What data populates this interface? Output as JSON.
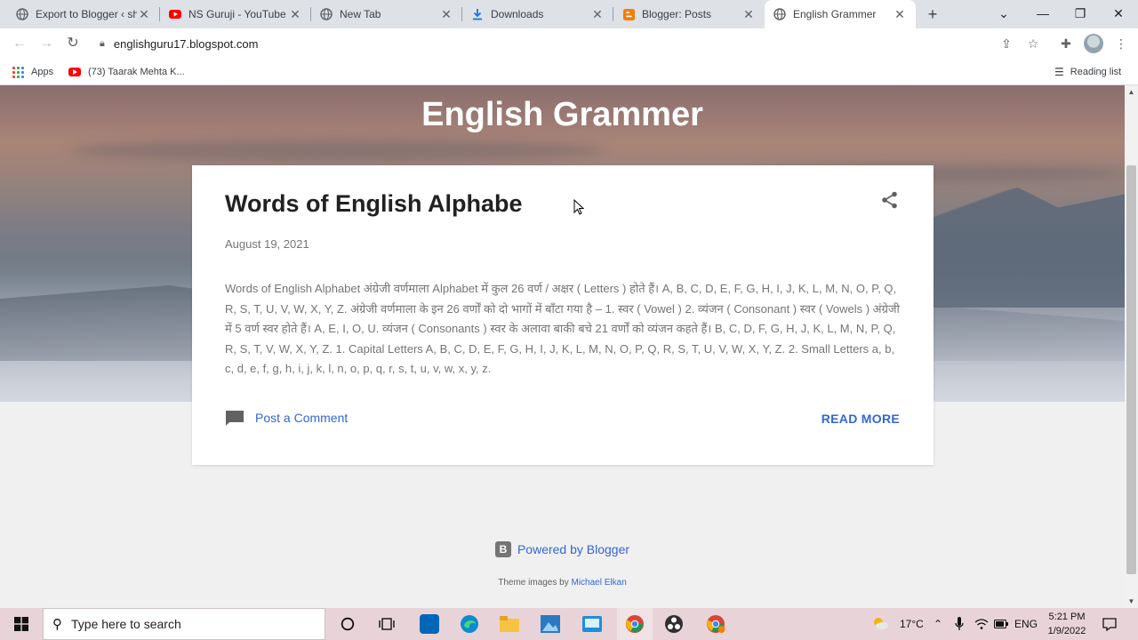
{
  "browser": {
    "tabs": [
      {
        "title": "Export to Blogger ‹ sh",
        "icon": "globe-icon",
        "active": false
      },
      {
        "title": "NS Guruji - YouTube",
        "icon": "youtube-icon",
        "active": false
      },
      {
        "title": "New Tab",
        "icon": "globe-icon",
        "active": false
      },
      {
        "title": "Downloads",
        "icon": "download-icon",
        "active": false
      },
      {
        "title": "Blogger: Posts",
        "icon": "blogger-icon",
        "active": false
      },
      {
        "title": "English Grammer",
        "icon": "globe-icon",
        "active": true
      }
    ],
    "url": "englishguru17.blogspot.com",
    "bookmarks": {
      "apps_label": "Apps",
      "item1": "(73) Taarak Mehta K...",
      "reading_list": "Reading list"
    }
  },
  "blog": {
    "title": "English Grammer",
    "post": {
      "title": "Words of English Alphabe",
      "date": "August 19, 2021",
      "snippet": "Words of English Alphabet अंग्रेजी वर्णमाला Alphabet में कुल 26 वर्ण / अक्षर ( Letters ) होते हैं। A, B, C, D, E, F, G, H, I, J, K, L, M, N, O, P, Q, R, S, T, U, V, W, X, Y, Z. अंग्रेजी वर्णमाला के इन 26 वर्णों को दो भागों में बाँटा गया है – 1. स्वर ( Vowel ) 2. व्यंजन ( Consonant ) स्वर ( Vowels ) अंग्रेजी में 5 वर्ण स्वर होते हैं। A, E, I, O, U. व्यंजन ( Consonants ) स्वर के अलावा बाकी बचे 21 वर्णों को व्यंजन कहते हैं। B, C, D, F, G, H, J, K, L, M, N, P, Q, R, S, T, V, W, X, Y, Z. 1. Capital Letters A, B, C, D, E, F, G, H, I, J, K, L, M, N, O, P, Q, R, S, T, U, V, W, X, Y, Z. 2. Small Letters a, b, c, d, e, f, g, h, i, j, k, l, n, o, p, q, r, s, t, u, v, w, x, y, z.",
      "comment_label": "Post a Comment",
      "read_more": "READ MORE"
    },
    "footer": {
      "powered": "Powered by Blogger",
      "theme_prefix": "Theme images by",
      "theme_author": "Michael Elkan"
    }
  },
  "taskbar": {
    "search_placeholder": "Type here to search",
    "weather": "17°C",
    "language": "ENG",
    "time": "5:21 PM",
    "date": "1/9/2022"
  },
  "colors": {
    "link": "#3367d6",
    "youtube": "#ff0000",
    "blogger": "#f57d00"
  }
}
